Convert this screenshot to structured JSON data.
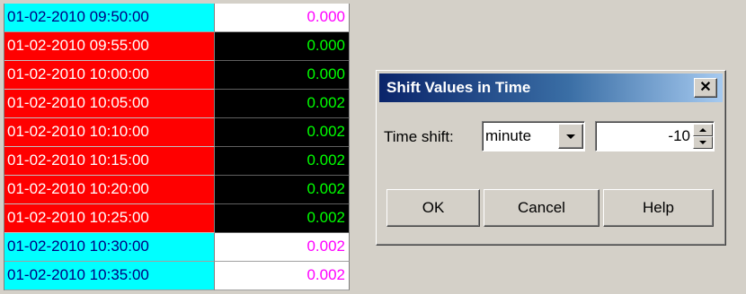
{
  "grid": {
    "rows": [
      {
        "time": "01-02-2010 09:50:00",
        "value": "0.000",
        "state": "normal"
      },
      {
        "time": "01-02-2010 09:55:00",
        "value": "0.000",
        "state": "flagged"
      },
      {
        "time": "01-02-2010 10:00:00",
        "value": "0.000",
        "state": "flagged"
      },
      {
        "time": "01-02-2010 10:05:00",
        "value": "0.002",
        "state": "flagged"
      },
      {
        "time": "01-02-2010 10:10:00",
        "value": "0.002",
        "state": "flagged"
      },
      {
        "time": "01-02-2010 10:15:00",
        "value": "0.002",
        "state": "flagged"
      },
      {
        "time": "01-02-2010 10:20:00",
        "value": "0.002",
        "state": "flagged"
      },
      {
        "time": "01-02-2010 10:25:00",
        "value": "0.002",
        "state": "flagged"
      },
      {
        "time": "01-02-2010 10:30:00",
        "value": "0.002",
        "state": "normal"
      },
      {
        "time": "01-02-2010 10:35:00",
        "value": "0.002",
        "state": "normal"
      }
    ],
    "colors": {
      "normal_time_bg": "#00ffff",
      "normal_value_text": "#ff00ff",
      "flagged_time_bg": "#ff0000",
      "flagged_value_bg": "#000000",
      "flagged_value_text": "#00ff00"
    }
  },
  "dialog": {
    "title": "Shift Values in Time",
    "close_icon": "close-icon",
    "close_glyph": "✕",
    "shift_label": "Time shift:",
    "unit_value": "minute",
    "amount_value": "-10",
    "buttons": {
      "ok": "OK",
      "cancel": "Cancel",
      "help": "Help"
    }
  }
}
